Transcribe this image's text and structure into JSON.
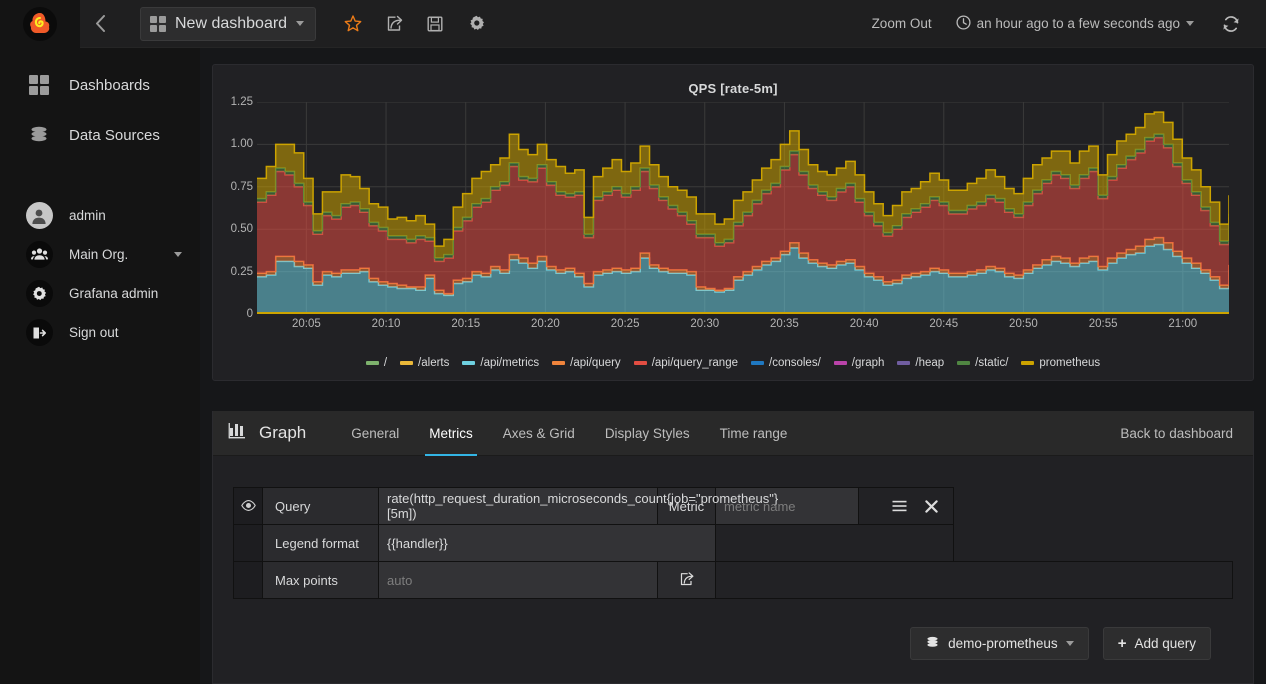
{
  "navbar": {
    "logo_icon": "grafana-logo-icon",
    "collapse_icon": "chevron-left-icon",
    "dashboard_title": "New dashboard",
    "dashboard_grid_icon": "grid-icon",
    "dashboard_caret_icon": "chevron-down-icon",
    "icons": [
      {
        "name": "star-icon",
        "label": "Mark as favorite"
      },
      {
        "name": "share-icon",
        "label": "Share dashboard"
      },
      {
        "name": "save-icon",
        "label": "Save dashboard"
      },
      {
        "name": "gear-icon",
        "label": "Dashboard settings"
      }
    ],
    "zoom_out": "Zoom Out",
    "clock_icon": "clock-icon",
    "time_range": "an hour ago to a few seconds ago",
    "time_caret_icon": "chevron-down-icon",
    "refresh_icon": "refresh-icon"
  },
  "sidebar": {
    "items": [
      {
        "label": "Dashboards",
        "icon": "grid-icon"
      },
      {
        "label": "Data Sources",
        "icon": "database-icon"
      }
    ],
    "user": [
      {
        "label": "admin",
        "icon": "user-avatar-icon",
        "caret": false
      },
      {
        "label": "Main Org.",
        "icon": "users-icon",
        "caret": true
      },
      {
        "label": "Grafana admin",
        "icon": "gear-icon",
        "caret": false
      },
      {
        "label": "Sign out",
        "icon": "sign-out-icon",
        "caret": false
      }
    ]
  },
  "panel": {
    "title": "QPS [rate-5m]"
  },
  "chart_data": {
    "type": "area",
    "title": "QPS [rate-5m]",
    "stacked": true,
    "xlabel": "",
    "ylabel": "",
    "ylim": [
      0,
      1.25
    ],
    "y_ticks": [
      "0",
      "0.25",
      "0.50",
      "0.75",
      "1.00",
      "1.25"
    ],
    "y_tick_values": [
      0,
      0.25,
      0.5,
      0.75,
      1.0,
      1.25
    ],
    "x_ticks": [
      "20:05",
      "20:10",
      "20:15",
      "20:20",
      "20:25",
      "20:30",
      "20:35",
      "20:40",
      "20:45",
      "20:50",
      "20:55",
      "21:00"
    ],
    "grid": true,
    "legend_position": "bottom",
    "legend": [
      {
        "name": "/",
        "color": "#7EB26D"
      },
      {
        "name": "/alerts",
        "color": "#EAB839"
      },
      {
        "name": "/api/metrics",
        "color": "#6ED0E0"
      },
      {
        "name": "/api/query",
        "color": "#EF843C"
      },
      {
        "name": "/api/query_range",
        "color": "#E24D42"
      },
      {
        "name": "/consoles/",
        "color": "#1F78C1"
      },
      {
        "name": "/graph",
        "color": "#BA43A9"
      },
      {
        "name": "/heap",
        "color": "#705DA0"
      },
      {
        "name": "/static/",
        "color": "#508642"
      },
      {
        "name": "prometheus",
        "color": "#CCA300"
      }
    ],
    "series": [
      {
        "name": "/api/metrics",
        "color": "#6ED0E0",
        "values": [
          0.22,
          0.23,
          0.31,
          0.31,
          0.28,
          0.27,
          0.17,
          0.23,
          0.22,
          0.24,
          0.24,
          0.25,
          0.19,
          0.17,
          0.16,
          0.15,
          0.15,
          0.14,
          0.21,
          0.12,
          0.11,
          0.18,
          0.19,
          0.23,
          0.22,
          0.26,
          0.24,
          0.32,
          0.3,
          0.27,
          0.31,
          0.26,
          0.24,
          0.25,
          0.22,
          0.16,
          0.23,
          0.24,
          0.25,
          0.24,
          0.25,
          0.33,
          0.27,
          0.25,
          0.24,
          0.24,
          0.23,
          0.14,
          0.14,
          0.13,
          0.14,
          0.2,
          0.23,
          0.26,
          0.29,
          0.31,
          0.35,
          0.39,
          0.33,
          0.3,
          0.28,
          0.27,
          0.29,
          0.3,
          0.26,
          0.22,
          0.2,
          0.17,
          0.18,
          0.21,
          0.22,
          0.23,
          0.25,
          0.24,
          0.22,
          0.22,
          0.23,
          0.24,
          0.26,
          0.25,
          0.22,
          0.21,
          0.24,
          0.27,
          0.29,
          0.31,
          0.3,
          0.28,
          0.3,
          0.31,
          0.26,
          0.3,
          0.33,
          0.35,
          0.36,
          0.4,
          0.41,
          0.38,
          0.34,
          0.3,
          0.27,
          0.24,
          0.2,
          0.15,
          0.26
        ]
      },
      {
        "name": "/api/query",
        "color": "#EF843C",
        "values": [
          0.02,
          0.02,
          0.03,
          0.03,
          0.03,
          0.02,
          0.02,
          0.02,
          0.02,
          0.02,
          0.02,
          0.02,
          0.02,
          0.02,
          0.02,
          0.02,
          0.01,
          0.02,
          0.02,
          0.02,
          0.01,
          0.02,
          0.02,
          0.02,
          0.02,
          0.02,
          0.02,
          0.03,
          0.03,
          0.03,
          0.03,
          0.02,
          0.02,
          0.02,
          0.02,
          0.02,
          0.02,
          0.02,
          0.02,
          0.02,
          0.02,
          0.03,
          0.02,
          0.02,
          0.02,
          0.02,
          0.02,
          0.02,
          0.01,
          0.01,
          0.01,
          0.02,
          0.02,
          0.02,
          0.02,
          0.02,
          0.02,
          0.03,
          0.03,
          0.02,
          0.02,
          0.02,
          0.02,
          0.02,
          0.02,
          0.02,
          0.02,
          0.02,
          0.02,
          0.02,
          0.02,
          0.02,
          0.02,
          0.02,
          0.02,
          0.02,
          0.02,
          0.02,
          0.02,
          0.02,
          0.02,
          0.02,
          0.02,
          0.02,
          0.03,
          0.03,
          0.03,
          0.02,
          0.03,
          0.03,
          0.02,
          0.03,
          0.03,
          0.03,
          0.04,
          0.04,
          0.04,
          0.04,
          0.03,
          0.03,
          0.03,
          0.02,
          0.02,
          0.02,
          0.03
        ]
      },
      {
        "name": "/api/query_range",
        "color": "#E24D42",
        "values": [
          0.42,
          0.45,
          0.5,
          0.48,
          0.44,
          0.35,
          0.28,
          0.33,
          0.32,
          0.37,
          0.38,
          0.33,
          0.31,
          0.3,
          0.26,
          0.27,
          0.26,
          0.28,
          0.2,
          0.17,
          0.21,
          0.29,
          0.34,
          0.38,
          0.42,
          0.45,
          0.5,
          0.52,
          0.46,
          0.48,
          0.52,
          0.48,
          0.44,
          0.42,
          0.46,
          0.27,
          0.42,
          0.44,
          0.46,
          0.43,
          0.46,
          0.48,
          0.45,
          0.4,
          0.36,
          0.32,
          0.28,
          0.29,
          0.3,
          0.26,
          0.27,
          0.3,
          0.33,
          0.37,
          0.4,
          0.42,
          0.48,
          0.52,
          0.46,
          0.42,
          0.4,
          0.38,
          0.41,
          0.43,
          0.38,
          0.34,
          0.3,
          0.27,
          0.3,
          0.34,
          0.36,
          0.38,
          0.4,
          0.38,
          0.35,
          0.35,
          0.37,
          0.38,
          0.4,
          0.39,
          0.36,
          0.34,
          0.38,
          0.42,
          0.45,
          0.48,
          0.47,
          0.44,
          0.47,
          0.5,
          0.4,
          0.46,
          0.5,
          0.53,
          0.55,
          0.58,
          0.59,
          0.56,
          0.5,
          0.44,
          0.4,
          0.35,
          0.3,
          0.24,
          0.28
        ]
      },
      {
        "name": "/static/",
        "color": "#508642",
        "values": [
          0.02,
          0.02,
          0.02,
          0.02,
          0.02,
          0.02,
          0.02,
          0.02,
          0.02,
          0.02,
          0.02,
          0.02,
          0.02,
          0.02,
          0.02,
          0.02,
          0.02,
          0.02,
          0.02,
          0.02,
          0.02,
          0.02,
          0.02,
          0.02,
          0.02,
          0.02,
          0.02,
          0.02,
          0.02,
          0.02,
          0.02,
          0.02,
          0.02,
          0.02,
          0.02,
          0.02,
          0.02,
          0.02,
          0.02,
          0.02,
          0.02,
          0.02,
          0.02,
          0.02,
          0.02,
          0.02,
          0.02,
          0.02,
          0.02,
          0.02,
          0.02,
          0.02,
          0.02,
          0.02,
          0.02,
          0.02,
          0.02,
          0.02,
          0.02,
          0.02,
          0.02,
          0.02,
          0.02,
          0.02,
          0.02,
          0.02,
          0.02,
          0.02,
          0.02,
          0.02,
          0.02,
          0.02,
          0.02,
          0.02,
          0.02,
          0.02,
          0.02,
          0.02,
          0.02,
          0.02,
          0.02,
          0.02,
          0.02,
          0.02,
          0.02,
          0.02,
          0.02,
          0.02,
          0.02,
          0.02,
          0.02,
          0.02,
          0.02,
          0.02,
          0.02,
          0.02,
          0.02,
          0.02,
          0.02,
          0.02,
          0.02,
          0.02,
          0.02,
          0.02,
          0.02
        ]
      },
      {
        "name": "prometheus",
        "color": "#CCA300",
        "values": [
          0.12,
          0.15,
          0.14,
          0.16,
          0.18,
          0.14,
          0.1,
          0.12,
          0.14,
          0.17,
          0.15,
          0.12,
          0.11,
          0.12,
          0.1,
          0.11,
          0.11,
          0.12,
          0.08,
          0.07,
          0.09,
          0.12,
          0.14,
          0.15,
          0.16,
          0.13,
          0.14,
          0.17,
          0.16,
          0.14,
          0.12,
          0.13,
          0.15,
          0.12,
          0.13,
          0.1,
          0.12,
          0.14,
          0.16,
          0.13,
          0.14,
          0.13,
          0.12,
          0.12,
          0.11,
          0.13,
          0.14,
          0.12,
          0.12,
          0.11,
          0.12,
          0.13,
          0.12,
          0.12,
          0.13,
          0.14,
          0.13,
          0.12,
          0.13,
          0.12,
          0.12,
          0.13,
          0.12,
          0.13,
          0.14,
          0.12,
          0.11,
          0.1,
          0.12,
          0.13,
          0.12,
          0.13,
          0.14,
          0.13,
          0.12,
          0.12,
          0.13,
          0.14,
          0.15,
          0.13,
          0.12,
          0.12,
          0.14,
          0.15,
          0.13,
          0.12,
          0.14,
          0.13,
          0.14,
          0.13,
          0.12,
          0.13,
          0.14,
          0.13,
          0.13,
          0.14,
          0.13,
          0.13,
          0.14,
          0.13,
          0.13,
          0.12,
          0.12,
          0.1,
          0.11
        ]
      }
    ]
  },
  "editor": {
    "brand": "Graph",
    "brand_icon": "bar-chart-icon",
    "tabs": [
      {
        "label": "General",
        "active": false
      },
      {
        "label": "Metrics",
        "active": true
      },
      {
        "label": "Axes & Grid",
        "active": false
      },
      {
        "label": "Display Styles",
        "active": false
      },
      {
        "label": "Time range",
        "active": false
      }
    ],
    "back_link": "Back to dashboard",
    "rows": {
      "query_label": "Query",
      "query_value": "rate(http_request_duration_microseconds_count{job=\"prometheus\"}[5m])",
      "eye_icon": "eye-icon",
      "metric_label": "Metric",
      "metric_placeholder": "metric name",
      "menu_icon": "hamburger-icon",
      "remove_icon": "close-icon",
      "legend_label": "Legend format",
      "legend_value": "{{handler}}",
      "maxpoints_label": "Max points",
      "maxpoints_placeholder": "auto",
      "maxpoints_icon": "external-link-icon"
    },
    "datasource": "demo-prometheus",
    "datasource_icon": "database-icon",
    "datasource_caret_icon": "chevron-down-icon",
    "add_query": "Add query",
    "add_query_icon": "plus-icon"
  }
}
